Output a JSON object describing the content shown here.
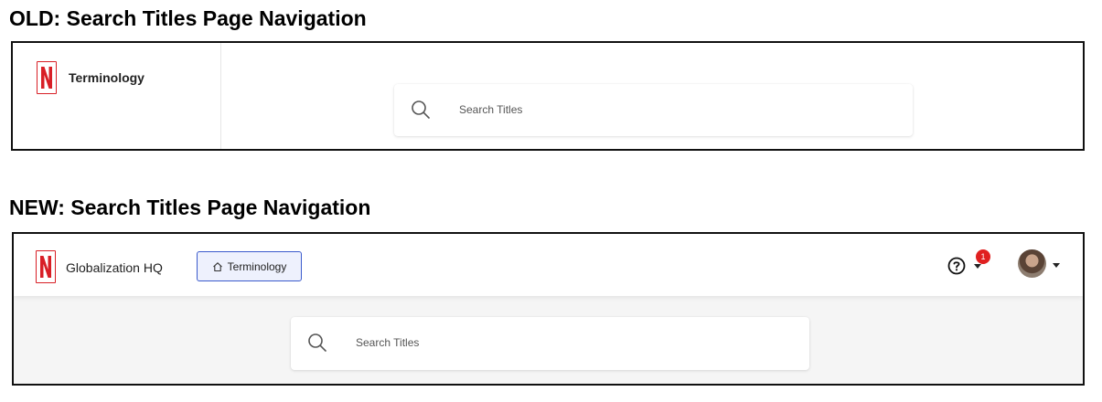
{
  "old": {
    "heading": "OLD: Search Titles Page Navigation",
    "app_title": "Terminology",
    "logo_letter": "N",
    "search": {
      "placeholder": "Search Titles"
    }
  },
  "new": {
    "heading": "NEW: Search Titles Page Navigation",
    "app_title": "Globalization HQ",
    "logo_letter": "N",
    "terminology_button": {
      "label": "Terminology",
      "icon": "home-icon"
    },
    "help_icon": "question-circle-icon",
    "notification_count": "1",
    "avatar": "user-avatar",
    "search": {
      "placeholder": "Search Titles"
    }
  },
  "colors": {
    "brand_red": "#d81f26",
    "button_border": "#3b5bcc",
    "button_bg": "#eef1fd",
    "badge_red": "#e02020",
    "page_bg_new": "#f5f5f5"
  }
}
